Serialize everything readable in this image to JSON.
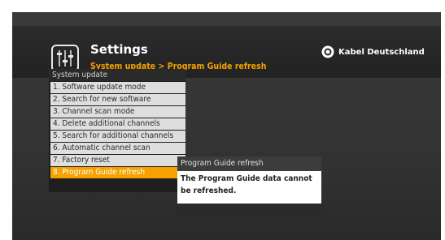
{
  "header": {
    "title": "Settings",
    "breadcrumb": "System update > Program Guide refresh",
    "brand": "Kabel Deutschland"
  },
  "menu": {
    "heading": "System update",
    "items": [
      {
        "label": "1. Software update mode"
      },
      {
        "label": "2. Search for new software"
      },
      {
        "label": "3. Channel scan mode"
      },
      {
        "label": "4. Delete additional channels"
      },
      {
        "label": "5. Search for additional channels"
      },
      {
        "label": "6. Automatic channel scan"
      },
      {
        "label": "7. Factory reset"
      },
      {
        "label": "8. Program Guide refresh"
      }
    ],
    "selected_index": 7
  },
  "info": {
    "title": "Program Guide refresh",
    "message": "The Program Guide data cannot be refreshed."
  },
  "colors": {
    "accent": "#f5a200",
    "background": "#333333",
    "menu_item": "#dedede"
  },
  "icons": {
    "settings": "equalizer-sliders-icon",
    "brand": "kabel-deutschland-logo-icon"
  }
}
